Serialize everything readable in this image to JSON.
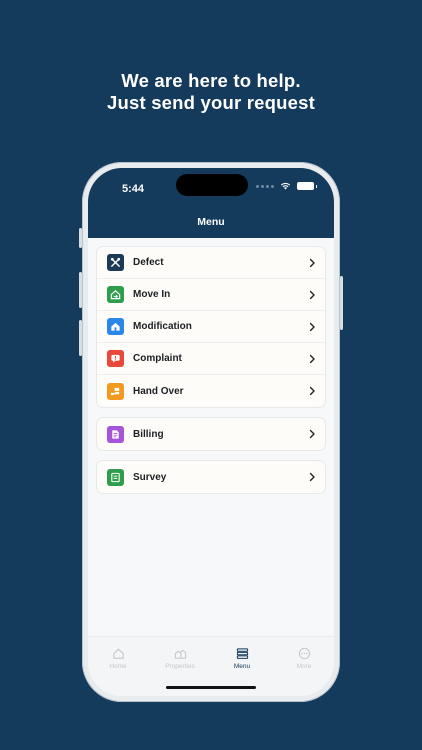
{
  "headline": {
    "line1": "We are here to help.",
    "line2": "Just send your request"
  },
  "status": {
    "time": "5:44"
  },
  "header": {
    "title": "Menu"
  },
  "menu_groups": [
    {
      "items": [
        {
          "label": "Defect",
          "icon": "tools-icon",
          "color": "#1b3b58"
        },
        {
          "label": "Move In",
          "icon": "move-in-icon",
          "color": "#2e9e4c"
        },
        {
          "label": "Modification",
          "icon": "modification-icon",
          "color": "#2a86e8"
        },
        {
          "label": "Complaint",
          "icon": "complaint-icon",
          "color": "#e8473a"
        },
        {
          "label": "Hand Over",
          "icon": "hand-over-icon",
          "color": "#f29a1f"
        }
      ]
    },
    {
      "items": [
        {
          "label": "Billing",
          "icon": "billing-icon",
          "color": "#a654d8"
        }
      ]
    },
    {
      "items": [
        {
          "label": "Survey",
          "icon": "survey-icon",
          "color": "#2e9e4c"
        }
      ]
    }
  ],
  "tabbar": {
    "items": [
      {
        "label": "Home",
        "icon": "home-icon"
      },
      {
        "label": "Properties",
        "icon": "properties-icon"
      },
      {
        "label": "Menu",
        "icon": "menu-list-icon",
        "active": true
      },
      {
        "label": "More",
        "icon": "more-icon"
      }
    ]
  },
  "colors": {
    "background": "#143a5c",
    "accent": "#143a5c"
  }
}
